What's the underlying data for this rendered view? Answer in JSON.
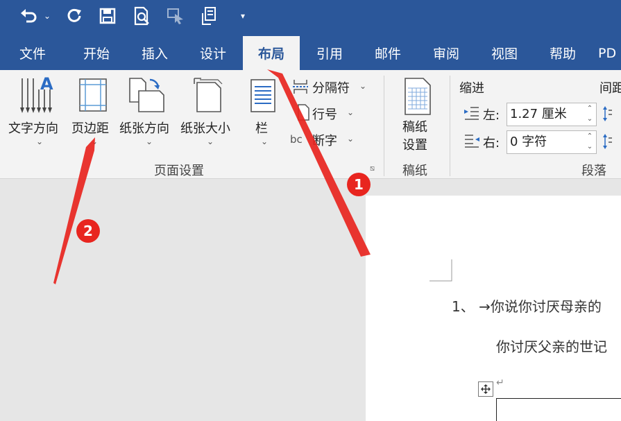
{
  "qat": {
    "undo_icon": "undo-icon",
    "redo_icon": "redo-icon",
    "save_icon": "save-icon",
    "print_preview_icon": "print-preview-icon",
    "touch_mode_icon": "touch-mode-icon",
    "customize_icon": "customize-icon"
  },
  "tabs": [
    "文件",
    "开始",
    "插入",
    "设计",
    "布局",
    "引用",
    "邮件",
    "审阅",
    "视图",
    "帮助",
    "PD"
  ],
  "active_tab": "布局",
  "page_setup": {
    "text_direction": "文字方向",
    "margins": "页边距",
    "orientation": "纸张方向",
    "size": "纸张大小",
    "columns": "栏",
    "breaks": "分隔符",
    "line_numbers": "行号",
    "hyphenation": "断字",
    "group_label": "页面设置"
  },
  "manuscript": {
    "button_line1": "稿纸",
    "button_line2": "设置",
    "group_label": "稿纸"
  },
  "paragraph": {
    "indent_title": "缩进",
    "spacing_title": "间距",
    "left_label": "左:",
    "left_value": "1.27 厘米",
    "right_label": "右:",
    "right_value": "0 字符",
    "group_label": "段落"
  },
  "document": {
    "line1": "1、 →你说你讨厌母亲的",
    "line2": "你讨厌父亲的世记"
  },
  "annotations": {
    "badge1": "1",
    "badge2": "2",
    "color": "#e8251f"
  },
  "colors": {
    "ribbon_blue": "#2b579a",
    "ribbon_bg": "#f3f3f3"
  }
}
